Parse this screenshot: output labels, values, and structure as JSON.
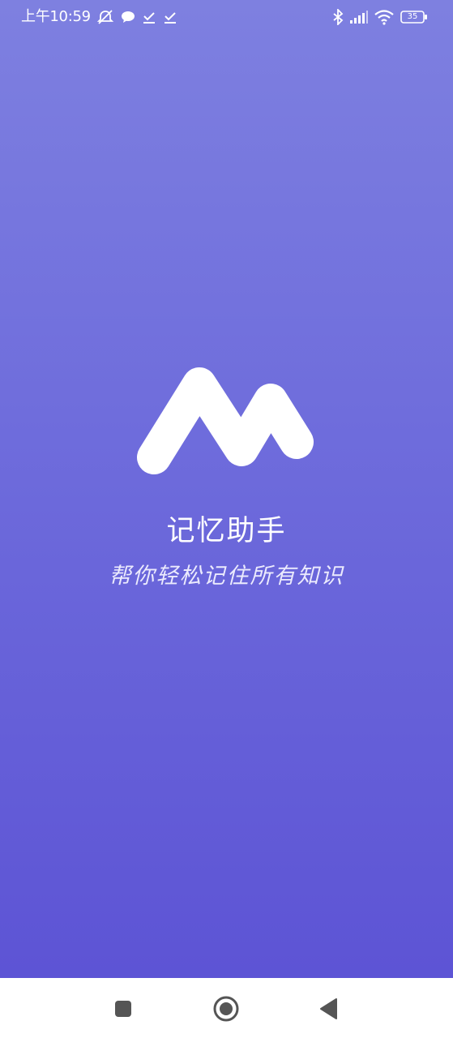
{
  "status_bar": {
    "time": "上午10:59",
    "battery_level": "35",
    "icons": [
      "mute-notification-icon",
      "chat-bubble-icon",
      "download-check-icon",
      "download-check-icon",
      "bluetooth-icon",
      "signal-icon",
      "wifi-icon",
      "battery-icon"
    ]
  },
  "splash": {
    "logo_icon": "m-logo-icon",
    "title": "记忆助手",
    "subtitle": "帮你轻松记住所有知识"
  },
  "nav_bar": {
    "buttons": [
      "recent-apps-button",
      "home-button",
      "back-button"
    ]
  },
  "colors": {
    "gradient_top": "#7e80e0",
    "gradient_bottom": "#5b51d4",
    "text": "#ffffff",
    "nav_bg": "#ffffff",
    "nav_icon": "#555555"
  }
}
